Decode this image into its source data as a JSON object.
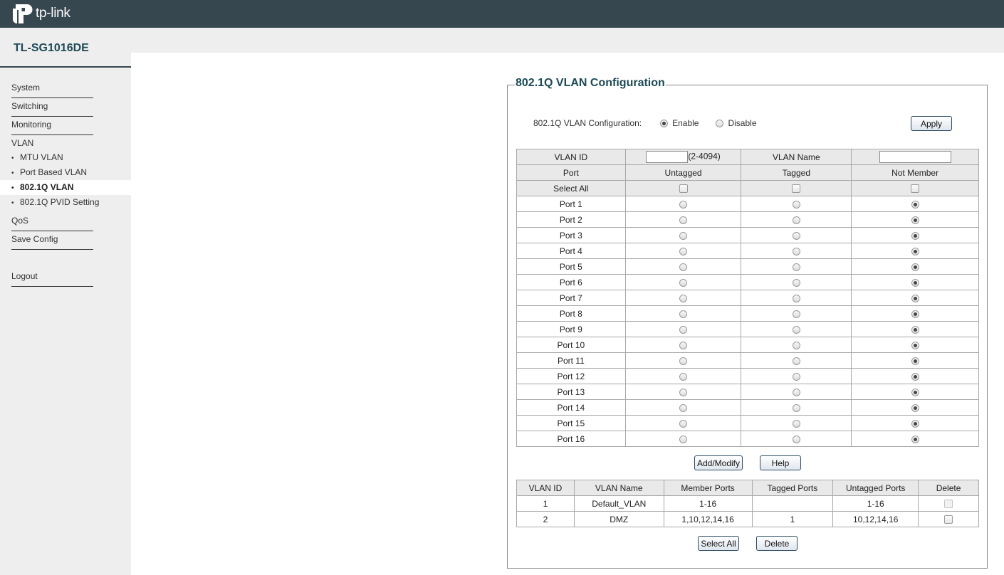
{
  "brand": {
    "logo_text": "tp-link"
  },
  "device": {
    "model": "TL-SG1016DE"
  },
  "sidebar": {
    "items": [
      {
        "label": "System"
      },
      {
        "label": "Switching"
      },
      {
        "label": "Monitoring"
      },
      {
        "label": "VLAN"
      }
    ],
    "vlan_sub": [
      {
        "label": "MTU VLAN",
        "active": false
      },
      {
        "label": "Port Based VLAN",
        "active": false
      },
      {
        "label": "802.1Q VLAN",
        "active": true
      },
      {
        "label": "802.1Q PVID Setting",
        "active": false
      }
    ],
    "items_after": [
      {
        "label": "QoS"
      },
      {
        "label": "Save Config"
      }
    ],
    "logout": "Logout"
  },
  "panel": {
    "title": "802.1Q VLAN Configuration",
    "config_label": "802.1Q VLAN Configuration:",
    "enable_label": "Enable",
    "disable_label": "Disable",
    "enabled": true,
    "apply_label": "Apply"
  },
  "vlan_form": {
    "vlan_id_label": "VLAN ID",
    "vlan_id_value": "",
    "vlan_id_range": "(2-4094)",
    "vlan_name_label": "VLAN Name",
    "vlan_name_value": "",
    "headers": {
      "port": "Port",
      "untagged": "Untagged",
      "tagged": "Tagged",
      "not_member": "Not Member"
    },
    "select_all_label": "Select All",
    "ports": [
      {
        "name": "Port 1",
        "membership": "not_member"
      },
      {
        "name": "Port 2",
        "membership": "not_member"
      },
      {
        "name": "Port 3",
        "membership": "not_member"
      },
      {
        "name": "Port 4",
        "membership": "not_member"
      },
      {
        "name": "Port 5",
        "membership": "not_member"
      },
      {
        "name": "Port 6",
        "membership": "not_member"
      },
      {
        "name": "Port 7",
        "membership": "not_member"
      },
      {
        "name": "Port 8",
        "membership": "not_member"
      },
      {
        "name": "Port 9",
        "membership": "not_member"
      },
      {
        "name": "Port 10",
        "membership": "not_member"
      },
      {
        "name": "Port 11",
        "membership": "not_member"
      },
      {
        "name": "Port 12",
        "membership": "not_member"
      },
      {
        "name": "Port 13",
        "membership": "not_member"
      },
      {
        "name": "Port 14",
        "membership": "not_member"
      },
      {
        "name": "Port 15",
        "membership": "not_member"
      },
      {
        "name": "Port 16",
        "membership": "not_member"
      }
    ],
    "add_modify_label": "Add/Modify",
    "help_label": "Help"
  },
  "vlan_list": {
    "headers": [
      "VLAN ID",
      "VLAN Name",
      "Member Ports",
      "Tagged Ports",
      "Untagged Ports",
      "Delete"
    ],
    "rows": [
      {
        "id": "1",
        "name": "Default_VLAN",
        "member": "1-16",
        "tagged": "",
        "untagged": "1-16",
        "deletable": false
      },
      {
        "id": "2",
        "name": "DMZ",
        "member": "1,10,12,14,16",
        "tagged": "1",
        "untagged": "10,12,14,16",
        "deletable": true
      }
    ],
    "select_all_label": "Select All",
    "delete_label": "Delete"
  }
}
